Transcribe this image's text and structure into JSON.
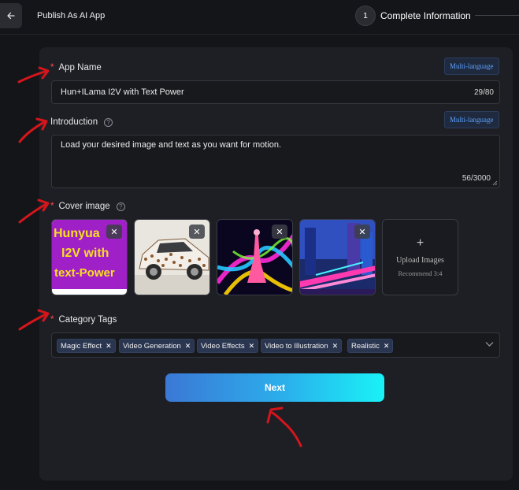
{
  "header": {
    "title": "Publish As AI App",
    "step_number": "1",
    "step_label": "Complete Information"
  },
  "app_name": {
    "label": "App Name",
    "value": "Hun+ILama I2V with Text Power",
    "counter": "29/80",
    "multilang": "Multi-language"
  },
  "introduction": {
    "label": "Introduction",
    "value": "Load your desired image and text as you want for motion.",
    "counter": "56/3000",
    "multilang": "Multi-language"
  },
  "cover": {
    "label": "Cover image",
    "thumbnail_text": [
      "Hunyua",
      "I2V with",
      "text-Power"
    ],
    "upload_label": "Upload Images",
    "upload_hint": "Recommend 3:4",
    "upload_plus": "+"
  },
  "category": {
    "label": "Category Tags",
    "tags": [
      "Magic Effect",
      "Video Generation",
      "Video Effects",
      "Video to Illustration",
      "Realistic"
    ]
  },
  "next_label": "Next",
  "colors": {
    "accent_start": "#3b78d6",
    "accent_end": "#19f2f6",
    "required": "#ff4d4f",
    "link": "#5aa2ff",
    "annotation": "#d4161c"
  },
  "icons": {
    "back": "arrow-left-icon",
    "help": "question-circle-icon",
    "close": "close-icon",
    "chevron": "chevron-down-icon"
  }
}
